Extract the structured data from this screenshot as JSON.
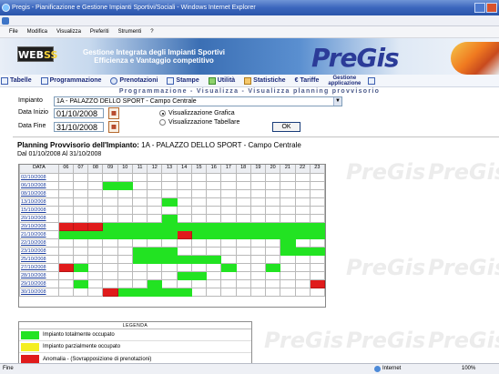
{
  "window": {
    "title": "Pregis - Pianificazione e Gestione Impianti Sportivi/Sociali - Windows Internet Explorer"
  },
  "menu": [
    "File",
    "Modifica",
    "Visualizza",
    "Preferiti",
    "Strumenti",
    "?"
  ],
  "banner": {
    "logo_left": "WEB",
    "logo_right": "SS",
    "tagline_1": "Gestione Integrata degli Impianti Sportivi",
    "tagline_2": "Efficienza e Vantaggio competitivo",
    "brand": "PreGis"
  },
  "nav": {
    "tabelle": "Tabelle",
    "programmazione": "Programmazione",
    "prenotazioni": "Prenotazioni",
    "stampe": "Stampe",
    "utilita": "Utilità",
    "statistiche": "Statistiche",
    "tariffe": "Tariffe",
    "gestione_1": "Gestione",
    "gestione_2": "applicazione"
  },
  "subtitle": "Programmazione - Visualizza - Visualizza planning provvisorio",
  "form": {
    "impianto_label": "Impianto",
    "impianto_value": "1A - PALAZZO DELLO SPORT - Campo Centrale",
    "data_inizio_label": "Data Inizio",
    "data_inizio_value": "01/10/2008",
    "data_fine_label": "Data Fine",
    "data_fine_value": "31/10/2008",
    "radio_grafica": "Visualizzazione Grafica",
    "radio_tabellare": "Visualizzazione Tabellare",
    "ok": "OK"
  },
  "planning": {
    "title_bold": "Planning Provvisorio dell'Impianto:",
    "title_rest": "1A - PALAZZO DELLO SPORT - Campo Centrale",
    "range": "Dal 01/10/2008 Al 31/10/2008",
    "date_header": "DATA",
    "hours": [
      "06",
      "07",
      "08",
      "09",
      "10",
      "11",
      "12",
      "13",
      "14",
      "15",
      "16",
      "17",
      "18",
      "19",
      "20",
      "21",
      "22",
      "23"
    ],
    "rows": [
      {
        "date": "02/10/2008",
        "cells": "------------------"
      },
      {
        "date": "06/10/2008",
        "cells": "---GG-------------"
      },
      {
        "date": "08/10/2008",
        "cells": "------------------"
      },
      {
        "date": "13/10/2008",
        "cells": "-------G----------"
      },
      {
        "date": "15/10/2008",
        "cells": "------------------"
      },
      {
        "date": "20/10/2008",
        "cells": "-------G----------"
      },
      {
        "date": "20/10/2008",
        "cells": "RRRGGGGGGGGGGGGGGG"
      },
      {
        "date": "21/10/2008",
        "cells": "GGGGGGGGRGGGGGGGGG"
      },
      {
        "date": "22/10/2008",
        "cells": "---------------G--"
      },
      {
        "date": "23/10/2008",
        "cells": "-----GGG-------GGG"
      },
      {
        "date": "25/10/2008",
        "cells": "-----GGGGGG-------"
      },
      {
        "date": "27/10/2008",
        "cells": "RG---------G--G---"
      },
      {
        "date": "28/10/2008",
        "cells": "--------GG--------"
      },
      {
        "date": "29/10/2008",
        "cells": "-G----G----------R"
      },
      {
        "date": "30/10/2008",
        "cells": "---RGGGGG---------"
      }
    ]
  },
  "legend": {
    "title": "LEGENDA",
    "items": [
      {
        "color": "#22e322",
        "label": "Impianto totalmente occupato"
      },
      {
        "color": "#f4ee22",
        "label": "Impianto parzialmente occupato"
      },
      {
        "color": "#e01b1b",
        "label": "Anomalia - (Sovrapposizione di prenotazioni)"
      }
    ]
  },
  "status": {
    "left": "Fine",
    "zone": "Internet",
    "zoom": "100%"
  }
}
